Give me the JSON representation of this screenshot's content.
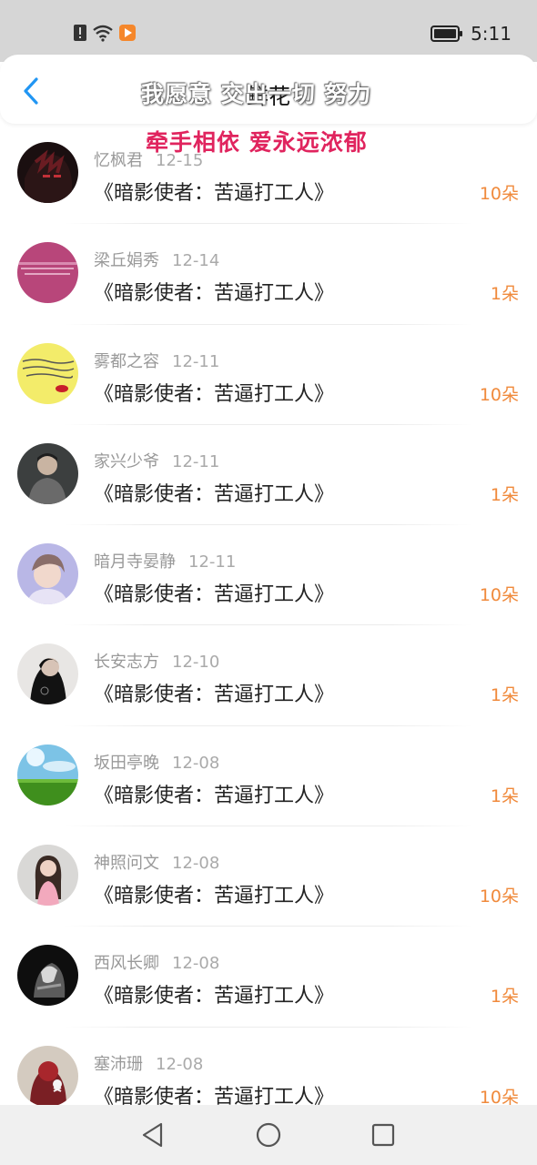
{
  "status_bar": {
    "time": "5:11",
    "icons": [
      "alert-icon",
      "wifi-icon",
      "play-app-icon",
      "battery-icon"
    ]
  },
  "header": {
    "title": "鲜花",
    "back_icon": "chevron-left-icon"
  },
  "danmaku": [
    "我愿意 交出一切 努力",
    "牵手相依 爱永远浓郁"
  ],
  "rows": [
    {
      "name": "忆枫君",
      "date": "12-15",
      "title": "《暗影使者：苦逼打工人》",
      "flowers": "10朵"
    },
    {
      "name": "梁丘娟秀",
      "date": "12-14",
      "title": "《暗影使者：苦逼打工人》",
      "flowers": "1朵"
    },
    {
      "name": "雾都之容",
      "date": "12-11",
      "title": "《暗影使者：苦逼打工人》",
      "flowers": "10朵"
    },
    {
      "name": "家兴少爷",
      "date": "12-11",
      "title": "《暗影使者：苦逼打工人》",
      "flowers": "1朵"
    },
    {
      "name": "暗月寺晏静",
      "date": "12-11",
      "title": "《暗影使者：苦逼打工人》",
      "flowers": "10朵"
    },
    {
      "name": "长安志方",
      "date": "12-10",
      "title": "《暗影使者：苦逼打工人》",
      "flowers": "1朵"
    },
    {
      "name": "坂田亭晚",
      "date": "12-08",
      "title": "《暗影使者：苦逼打工人》",
      "flowers": "1朵"
    },
    {
      "name": "神照问文",
      "date": "12-08",
      "title": "《暗影使者：苦逼打工人》",
      "flowers": "10朵"
    },
    {
      "name": "西风长卿",
      "date": "12-08",
      "title": "《暗影使者：苦逼打工人》",
      "flowers": "1朵"
    },
    {
      "name": "塞沛珊",
      "date": "12-08",
      "title": "《暗影使者：苦逼打工人》",
      "flowers": "10朵"
    }
  ],
  "colors": {
    "accent_blue": "#2196f3",
    "flower_orange": "#f08a3c",
    "danmaku_red": "#e0245e"
  }
}
